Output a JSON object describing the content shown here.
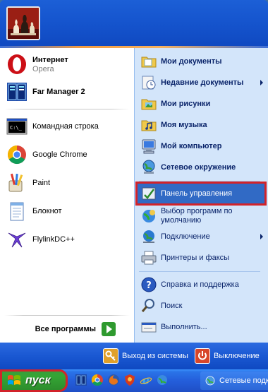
{
  "left": {
    "pinned": [
      {
        "title": "Интернет",
        "subtitle": "Opera"
      },
      {
        "title": "Far Manager 2"
      }
    ],
    "recent": [
      {
        "title": "Командная строка"
      },
      {
        "title": "Google Chrome"
      },
      {
        "title": "Paint"
      },
      {
        "title": "Блокнот"
      },
      {
        "title": "FlylinkDC++"
      }
    ],
    "all_programs": "Все программы"
  },
  "right": {
    "items": [
      {
        "label": "Мои документы"
      },
      {
        "label": "Недавние документы"
      },
      {
        "label": "Мои рисунки"
      },
      {
        "label": "Моя музыка"
      },
      {
        "label": "Мой компьютер"
      },
      {
        "label": "Сетевое окружение"
      },
      {
        "label": "Панель управления"
      },
      {
        "label": "Выбор программ по умолчанию"
      },
      {
        "label": "Подключение"
      },
      {
        "label": "Принтеры и факсы"
      },
      {
        "label": "Справка и поддержка"
      },
      {
        "label": "Поиск"
      },
      {
        "label": "Выполнить..."
      }
    ]
  },
  "footer": {
    "logoff": "Выход из системы",
    "shutdown": "Выключение"
  },
  "taskbar": {
    "start_label": "пуск",
    "task_label": "Сетевые подключения"
  },
  "colors": {
    "highlight_outline": "#d2232a",
    "selection": "#316ac5",
    "right_pane": "#d3e5fa",
    "header_blue": "#1656cf",
    "start_green": "#35a535"
  }
}
